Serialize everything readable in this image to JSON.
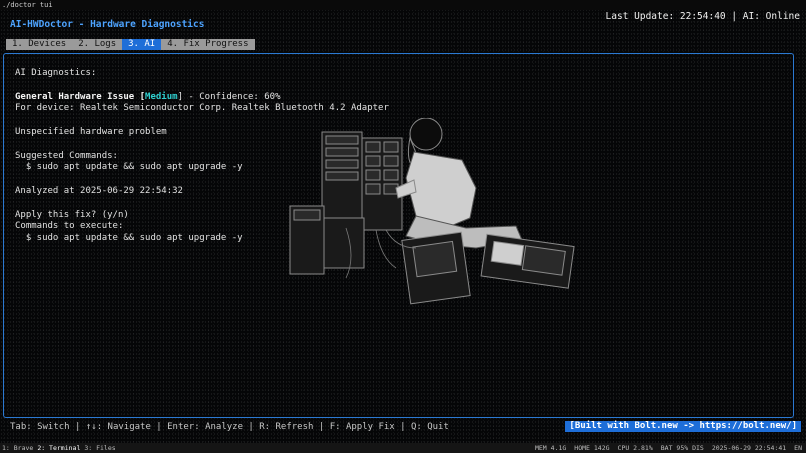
{
  "window": {
    "title": "./doctor tui"
  },
  "header": {
    "app_title": "AI-HWDoctor - Hardware Diagnostics",
    "last_update": "Last Update: 22:54:40 | AI: Online"
  },
  "tabs": [
    {
      "label": "1. Devices"
    },
    {
      "label": "2. Logs"
    },
    {
      "label": "3. AI"
    },
    {
      "label": "4. Fix Progress"
    }
  ],
  "diagnostics": {
    "heading": "AI Diagnostics:",
    "issue_title": "General Hardware Issue [",
    "severity": "Medium",
    "confidence": "] - Confidence: 60%",
    "device": "For device: Realtek Semiconductor Corp. Realtek Bluetooth 4.2 Adapter",
    "description": "Unspecified hardware problem",
    "suggested_label": "Suggested Commands:",
    "suggested_cmd": "  $ sudo apt update && sudo apt upgrade -y",
    "analyzed": "Analyzed at 2025-06-29 22:54:32",
    "apply_prompt": "Apply this fix? (y/n)",
    "commands_label": "Commands to execute:",
    "execute_cmd": "  $ sudo apt update && sudo apt upgrade -y"
  },
  "footer": {
    "hints": "Tab: Switch | ↑↓: Navigate | Enter: Analyze | R: Refresh | F: Apply Fix | Q: Quit",
    "bolt": "[Built with Bolt.new -> https://bolt.new/]"
  },
  "statusbar": {
    "windows": [
      "1: Brave",
      "2: Terminal",
      "3: Files"
    ],
    "mem": "MEM 4.1G",
    "home": "HOME 142G",
    "cpu": "CPU 2.81%",
    "bat": "BAT 95% DIS",
    "datetime": "2025-06-29 22:54:41",
    "lang": "EN"
  },
  "colors": {
    "accent": "#1e6ed8",
    "title": "#4da3ff",
    "severity": "#2fd0d0",
    "background": "#050607"
  }
}
